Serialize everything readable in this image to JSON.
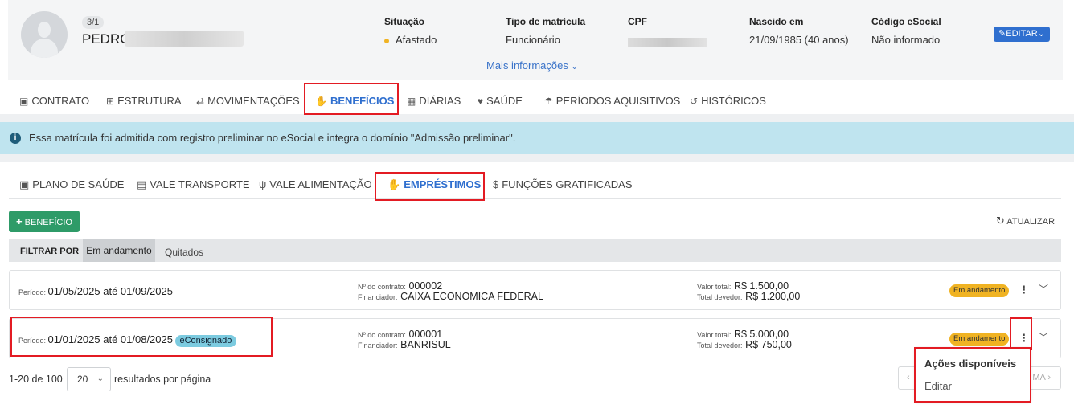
{
  "header": {
    "count_badge": "3/1",
    "name": "PEDRO",
    "fields": [
      {
        "label": "Situação",
        "value": "Afastado"
      },
      {
        "label": "Tipo de matrícula",
        "value": "Funcionário"
      },
      {
        "label": "CPF",
        "value": ""
      },
      {
        "label": "Nascido em",
        "value": "21/09/1985 (40 anos)"
      },
      {
        "label": "Código eSocial",
        "value": "Não informado"
      }
    ],
    "status_color": "#f0b323",
    "edit_label": "EDITAR",
    "more_info": "Mais informações"
  },
  "tabs": [
    {
      "label": "CONTRATO",
      "icon": "badge-icon"
    },
    {
      "label": "ESTRUTURA",
      "icon": "hierarchy-icon"
    },
    {
      "label": "MOVIMENTAÇÕES",
      "icon": "swap-icon"
    },
    {
      "label": "BENEFÍCIOS",
      "icon": "hand-heart-icon",
      "active": true
    },
    {
      "label": "DIÁRIAS",
      "icon": "building-icon"
    },
    {
      "label": "SAÚDE",
      "icon": "heart-pulse-icon"
    },
    {
      "label": "PERÍODOS AQUISITIVOS",
      "icon": "umbrella-beach-icon"
    },
    {
      "label": "HISTÓRICOS",
      "icon": "history-icon"
    }
  ],
  "info_alert": "Essa matrícula foi admitida com registro preliminar no eSocial e integra o domínio \"Admissão preliminar\".",
  "subtabs": [
    {
      "label": "PLANO DE SAÚDE",
      "icon": "medkit-icon"
    },
    {
      "label": "VALE TRANSPORTE",
      "icon": "bus-icon"
    },
    {
      "label": "VALE ALIMENTAÇÃO",
      "icon": "utensils-icon"
    },
    {
      "label": "EMPRÉSTIMOS",
      "icon": "hand-money-icon",
      "active": true
    },
    {
      "label": "FUNÇÕES GRATIFICADAS",
      "icon": "dollar-icon"
    }
  ],
  "actions": {
    "add_benefit": "BENEFÍCIO",
    "refresh": "ATUALIZAR"
  },
  "filter": {
    "label": "FILTRAR POR",
    "options": [
      "Em andamento",
      "Quitados"
    ],
    "selected": "Em andamento"
  },
  "loans": [
    {
      "period_label": "Período:",
      "period": "01/05/2025 até 01/09/2025",
      "contract_label": "Nº do contrato:",
      "contract": "000002",
      "financer_label": "Financiador:",
      "financer": "CAIXA ECONOMICA FEDERAL",
      "total_label": "Valor total:",
      "total": "R$ 1.500,00",
      "debt_label": "Total devedor:",
      "debt": "R$ 1.200,00",
      "status": "Em andamento",
      "tag": ""
    },
    {
      "period_label": "Período:",
      "period": "01/01/2025 até 01/08/2025",
      "contract_label": "Nº do contrato:",
      "contract": "000001",
      "financer_label": "Financiador:",
      "financer": "BANRISUL",
      "total_label": "Valor total:",
      "total": "R$ 5.000,00",
      "debt_label": "Total devedor:",
      "debt": "R$ 750,00",
      "status": "Em andamento",
      "tag": "eConsignado"
    }
  ],
  "pagination": {
    "range": "1-20 de 100",
    "per_page": "20",
    "per_page_label": "resultados por página",
    "next_fragment": "MA"
  },
  "context_menu": {
    "title": "Ações disponíveis",
    "items": [
      "Editar"
    ]
  },
  "colors": {
    "primary": "#2f6fcf",
    "success": "#2e9b68",
    "warning": "#f0b323",
    "info_bg": "#bfe4ef",
    "highlight": "#e31b23"
  }
}
